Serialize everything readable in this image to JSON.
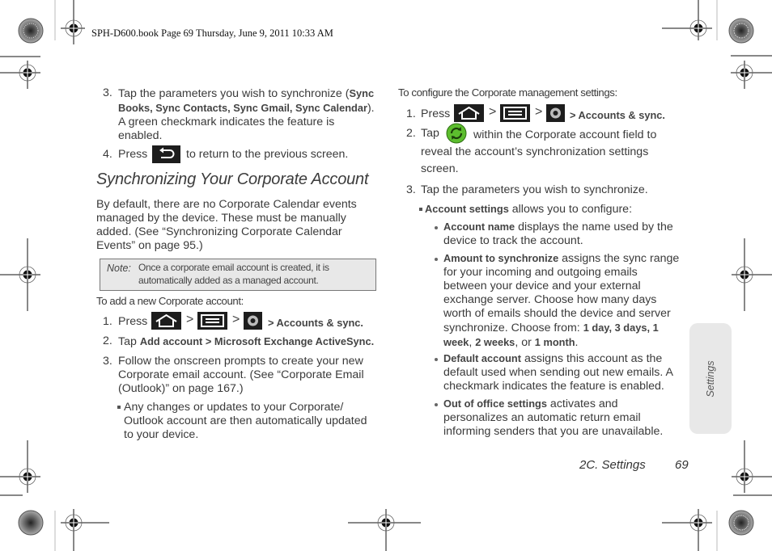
{
  "slug_line": "SPH-D600.book  Page 69  Thursday, June 9, 2011  10:33 AM",
  "left_column": {
    "step3": {
      "number": "3.",
      "text_before": "Tap the parameters you wish to synchronize (",
      "bold_items": [
        "Sync Books",
        "Sync Contacts",
        "Sync Gmail",
        "Sync Calendar"
      ],
      "line1_bold": "Sync",
      "line2_bold": "Books, Sync Contacts, Sync Gmail, Sync Calendar",
      "line2_after": ").",
      "line3": "A green checkmark indicates the feature is",
      "line4": "enabled."
    },
    "step4": {
      "number": "4.",
      "before": "Press",
      "icon": "back-key-icon",
      "after": "to return to the previous screen."
    },
    "heading": "Synchronizing Your Corporate Account",
    "paragraph_lines": [
      "By default, there are no Corporate Calendar events",
      "managed by the device. These must be manually",
      "added. (See “Synchronizing Corporate Calendar",
      "Events” on page 95.)"
    ],
    "note": {
      "label": "Note:",
      "lines": [
        "Once a corporate email account is created, it is",
        "automatically added as a managed account."
      ]
    },
    "intro": "To add a new Corporate account:",
    "steps": [
      {
        "number": "1.",
        "before": "Press",
        "icons": [
          "home-key-icon",
          "menu-key-icon",
          "settings-icon"
        ],
        "separator": ">",
        "bold_after": "> Accounts & sync."
      },
      {
        "number": "2.",
        "before": "Tap",
        "bold_after": "Add account > Microsoft Exchange ActiveSync."
      },
      {
        "number": "3.",
        "lines": [
          "Follow the onscreen prompts to create your new",
          "Corporate email account. (See “Corporate Email",
          "(Outlook)” on page 167.)"
        ]
      }
    ],
    "sub_bullet_lines": [
      "Any changes or updates to your Corporate/",
      "Outlook account are then automatically updated",
      "to your device."
    ]
  },
  "right_column": {
    "intro": "To configure the Corporate management settings:",
    "step1": {
      "number": "1.",
      "before": "Press",
      "separator": ">",
      "bold_after": "> Accounts & sync."
    },
    "step2": {
      "number": "2.",
      "before": "Tap",
      "icon": "sync-icon",
      "lines": [
        "within the Corporate account field to",
        "reveal the account’s synchronization settings",
        "screen."
      ]
    },
    "step3": {
      "number": "3.",
      "text": "Tap the parameters you wish to synchronize."
    },
    "account_settings": {
      "bold": "Account settings",
      "text": " allows you to configure:"
    },
    "options": [
      {
        "bold": "Account name",
        "lines": [
          " displays the name used by the",
          "device to track the account."
        ]
      },
      {
        "bold": "Amount to synchronize",
        "lines": [
          " assigns the sync range",
          "for your incoming and outgoing emails",
          "between your device and your external",
          "exchange server. Choose how many days",
          "worth of emails should the device and server"
        ],
        "choose_prefix": "synchronize. Choose from: ",
        "choices": [
          "1 day",
          "3 days",
          "1 week",
          "2 weeks",
          "1 month"
        ]
      },
      {
        "bold": "Default account",
        "lines": [
          " assigns this account as the",
          "default used when sending out new emails. A",
          "checkmark indicates the feature is enabled."
        ]
      },
      {
        "bold": "Out of office settings",
        "lines": [
          " activates and",
          "personalizes an automatic return email",
          "informing senders that you are unavailable."
        ]
      }
    ]
  },
  "side_tab": "Settings",
  "footer": {
    "section": "2C. Settings",
    "page": "69"
  },
  "colors": {
    "note_bg": "#e8e8e8",
    "sidetab_bg": "#e8e8e8",
    "key_bg": "#1d1d1d",
    "sync_green": "#5cbd2e"
  }
}
